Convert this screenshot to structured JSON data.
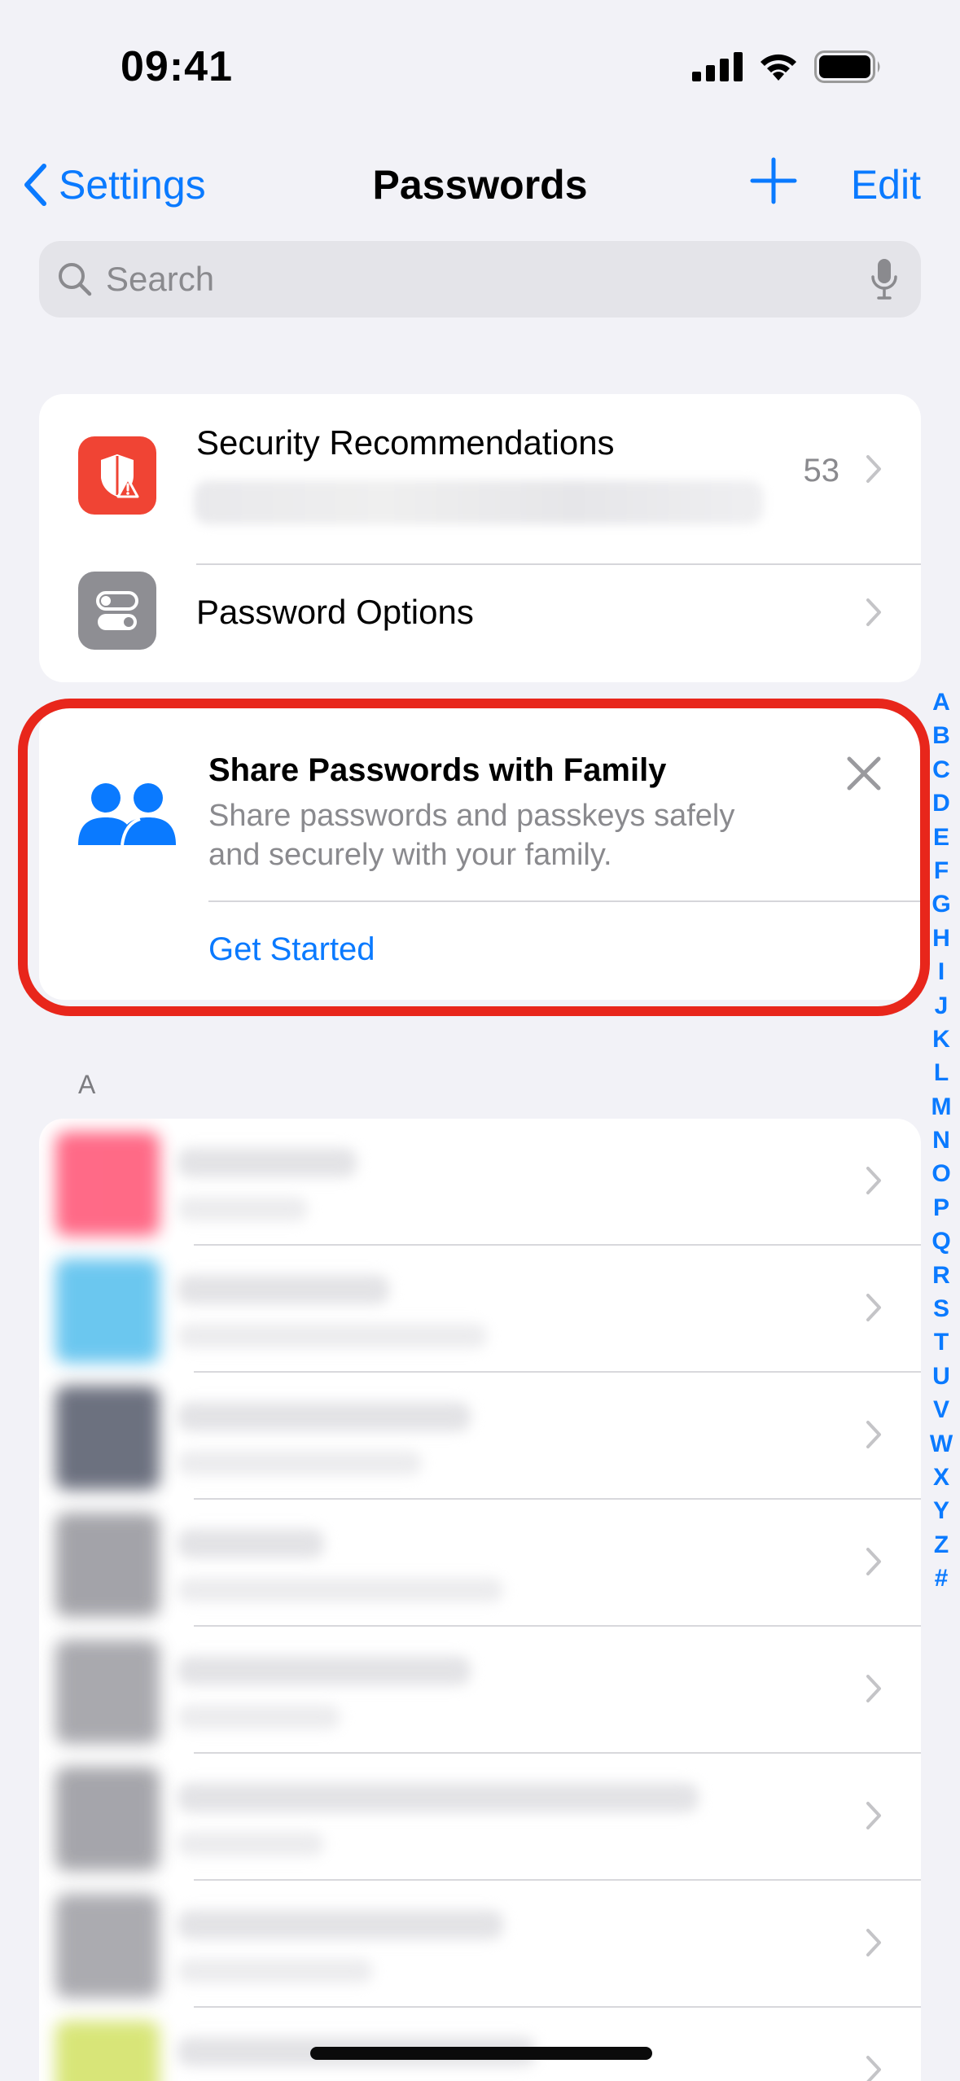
{
  "status": {
    "time": "09:41"
  },
  "nav": {
    "back_label": "Settings",
    "title": "Passwords",
    "edit_label": "Edit"
  },
  "search": {
    "placeholder": "Search"
  },
  "security": {
    "label": "Security Recommendations",
    "count": "53"
  },
  "options": {
    "label": "Password Options"
  },
  "share": {
    "title": "Share Passwords with Family",
    "description": "Share passwords and passkeys safely and securely with your family.",
    "cta": "Get Started"
  },
  "section": {
    "letter": "A"
  },
  "index_letters": [
    "A",
    "B",
    "C",
    "D",
    "E",
    "F",
    "G",
    "H",
    "I",
    "J",
    "K",
    "L",
    "M",
    "N",
    "O",
    "P",
    "Q",
    "R",
    "S",
    "T",
    "U",
    "V",
    "W",
    "X",
    "Y",
    "Z",
    "#"
  ],
  "colors": {
    "accent": "#0a7aff",
    "security_icon": "#f04434",
    "options_icon": "#8e8e93",
    "highlight": "#e8261b"
  }
}
